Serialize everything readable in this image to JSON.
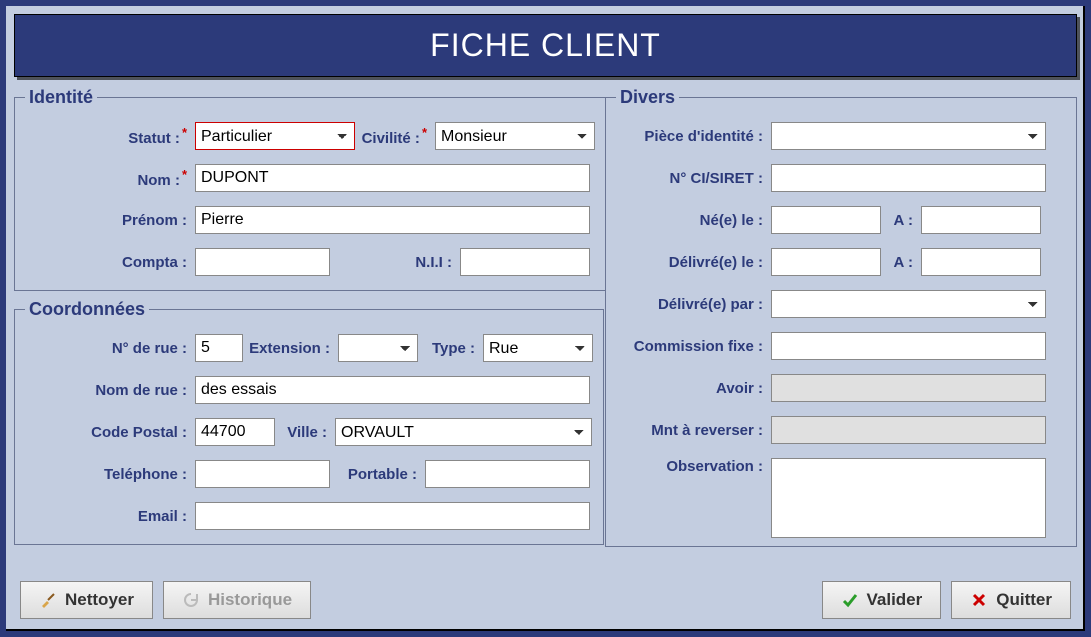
{
  "title": "FICHE CLIENT",
  "groups": {
    "identite": "Identité",
    "coordonnees": "Coordonnées",
    "divers": "Divers"
  },
  "identite": {
    "statut_label": "Statut :",
    "statut_value": "Particulier",
    "civilite_label": "Civilité :",
    "civilite_value": "Monsieur",
    "nom_label": "Nom :",
    "nom_value": "DUPONT",
    "prenom_label": "Prénom :",
    "prenom_value": "Pierre",
    "compta_label": "Compta :",
    "compta_value": "",
    "nii_label": "N.I.I :",
    "nii_value": ""
  },
  "coord": {
    "num_rue_label": "N° de rue :",
    "num_rue_value": "5",
    "extension_label": "Extension :",
    "extension_value": "",
    "type_label": "Type :",
    "type_value": "Rue",
    "nom_rue_label": "Nom de rue :",
    "nom_rue_value": "des essais",
    "cp_label": "Code Postal :",
    "cp_value": "44700",
    "ville_label": "Ville :",
    "ville_value": "ORVAULT",
    "tel_label": "Teléphone :",
    "tel_value": "",
    "portable_label": "Portable :",
    "portable_value": "",
    "email_label": "Email :",
    "email_value": ""
  },
  "divers": {
    "piece_label": "Pièce d'identité :",
    "piece_value": "",
    "ci_label": "N° CI/SIRET :",
    "ci_value": "",
    "ne_label": "Né(e) le :",
    "ne_value": "",
    "a1_label": "A :",
    "a1_value": "",
    "delivre_le_label": "Délivré(e) le :",
    "delivre_le_value": "",
    "a2_label": "A :",
    "a2_value": "",
    "delivre_par_label": "Délivré(e) par :",
    "delivre_par_value": "",
    "commission_label": "Commission fixe :",
    "commission_value": "",
    "avoir_label": "Avoir :",
    "avoir_value": "",
    "mnt_label": "Mnt à reverser :",
    "mnt_value": "",
    "obs_label": "Observation :",
    "obs_value": ""
  },
  "buttons": {
    "nettoyer": "Nettoyer",
    "historique": "Historique",
    "valider": "Valider",
    "quitter": "Quitter"
  }
}
